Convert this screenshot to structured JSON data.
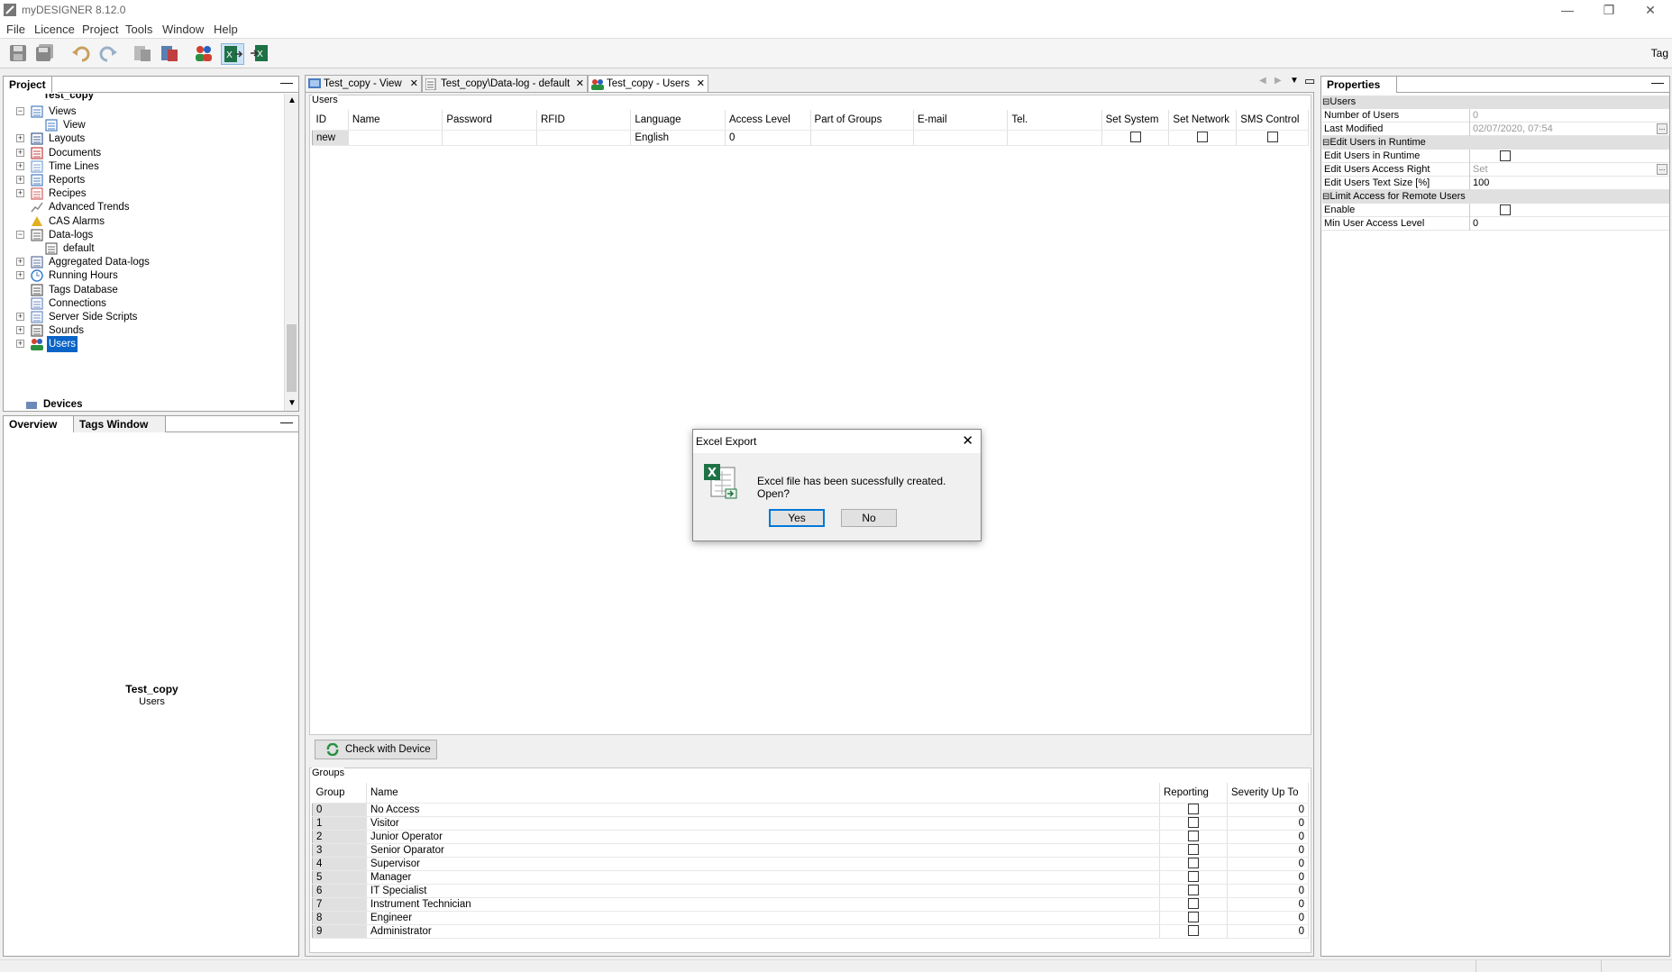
{
  "window": {
    "title": "myDESIGNER 8.12.0"
  },
  "menu": [
    "File",
    "Licence",
    "Project",
    "Tools",
    "Window",
    "Help"
  ],
  "toolbar": {
    "tag_label": "Tag"
  },
  "project_panel": {
    "tab": "Project",
    "root": "Test_copy",
    "items": [
      {
        "label": "Views",
        "icon": "views-icon",
        "expander": "−"
      },
      {
        "label": "View",
        "icon": "view-icon",
        "expander": ""
      },
      {
        "label": "Layouts",
        "icon": "layouts-icon",
        "expander": "+"
      },
      {
        "label": "Documents",
        "icon": "documents-icon",
        "expander": "+"
      },
      {
        "label": "Time Lines",
        "icon": "timelines-icon",
        "expander": "+"
      },
      {
        "label": "Reports",
        "icon": "reports-icon",
        "expander": "+"
      },
      {
        "label": "Recipes",
        "icon": "recipes-icon",
        "expander": "+"
      },
      {
        "label": "Advanced Trends",
        "icon": "trends-icon",
        "expander": ""
      },
      {
        "label": "CAS Alarms",
        "icon": "alarm-bell-icon",
        "expander": ""
      },
      {
        "label": "Data-logs",
        "icon": "datalogs-icon",
        "expander": "−"
      },
      {
        "label": "default",
        "icon": "datalog-icon",
        "expander": ""
      },
      {
        "label": "Aggregated Data-logs",
        "icon": "aggregated-icon",
        "expander": "+"
      },
      {
        "label": "Running Hours",
        "icon": "clock-icon",
        "expander": "+"
      },
      {
        "label": "Tags Database",
        "icon": "database-icon",
        "expander": ""
      },
      {
        "label": "Connections",
        "icon": "connections-icon",
        "expander": ""
      },
      {
        "label": "Server Side Scripts",
        "icon": "scripts-icon",
        "expander": "+"
      },
      {
        "label": "Sounds",
        "icon": "speaker-icon",
        "expander": "+"
      },
      {
        "label": "Users",
        "icon": "users-icon",
        "expander": "+"
      }
    ],
    "devices": "Devices"
  },
  "overview_panel": {
    "tabs": [
      "Overview",
      "Tags Window"
    ],
    "title": "Test_copy",
    "subtitle": "Users"
  },
  "doc_tabs": [
    {
      "label": "Test_copy - View",
      "icon": "view-icon"
    },
    {
      "label": "Test_copy\\Data-log - default",
      "icon": "datalog-icon"
    },
    {
      "label": "Test_copy - Users",
      "icon": "users-icon"
    }
  ],
  "users": {
    "group_label": "Users",
    "columns": [
      "ID",
      "Name",
      "Password",
      "RFID",
      "Language",
      "Access Level",
      "Part of Groups",
      "E-mail",
      "Tel.",
      "Set System",
      "Set Network",
      "SMS Control"
    ],
    "new_row": {
      "id": "new",
      "language": "English",
      "access_level": "0"
    }
  },
  "check_button": "Check with Device",
  "groups": {
    "group_label": "Groups",
    "columns": [
      "Group",
      "Name",
      "Reporting",
      "Severity Up To"
    ],
    "rows": [
      {
        "id": "0",
        "name": "No Access",
        "severity": "0"
      },
      {
        "id": "1",
        "name": "Visitor",
        "severity": "0"
      },
      {
        "id": "2",
        "name": "Junior Operator",
        "severity": "0"
      },
      {
        "id": "3",
        "name": "Senior Oparator",
        "severity": "0"
      },
      {
        "id": "4",
        "name": "Supervisor",
        "severity": "0"
      },
      {
        "id": "5",
        "name": "Manager",
        "severity": "0"
      },
      {
        "id": "6",
        "name": "IT Specialist",
        "severity": "0"
      },
      {
        "id": "7",
        "name": "Instrument Technician",
        "severity": "0"
      },
      {
        "id": "8",
        "name": "Engineer",
        "severity": "0"
      },
      {
        "id": "9",
        "name": "Administrator",
        "severity": "0"
      }
    ]
  },
  "properties": {
    "tab": "Properties",
    "cat_users": "Users",
    "number_of_users_label": "Number of Users",
    "number_of_users": "0",
    "last_modified_label": "Last Modified",
    "last_modified": "02/07/2020, 07:54",
    "cat_edit": "Edit Users in Runtime",
    "edit_users_label": "Edit Users in Runtime",
    "access_right_label": "Edit Users Access Right",
    "access_right": "Set",
    "text_size_label": "Edit Users Text Size [%]",
    "text_size": "100",
    "cat_limit": "Limit Access for Remote Users",
    "enable_label": "Enable",
    "min_level_label": "Min User Access Level",
    "min_level": "0"
  },
  "dialog": {
    "title": "Excel Export",
    "message": "Excel file has been sucessfully created. Open?",
    "yes": "Yes",
    "no": "No"
  },
  "colors": {
    "selection": "#0a64c8",
    "excel_green": "#1e7145"
  }
}
